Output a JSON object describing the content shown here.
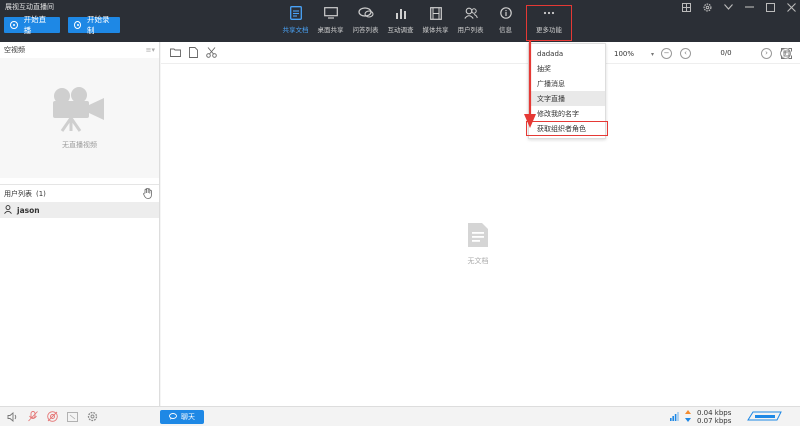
{
  "app": {
    "title": "展视互动直播间"
  },
  "header": {
    "start_live_label": "开始直播",
    "start_record_label": "开始录制",
    "tools": [
      {
        "label": "共享文档",
        "icon": "document-icon",
        "active": true
      },
      {
        "label": "桌面共享",
        "icon": "monitor-icon"
      },
      {
        "label": "问答列表",
        "icon": "chat-bubble-icon"
      },
      {
        "label": "互动调查",
        "icon": "bar-chart-icon"
      },
      {
        "label": "媒体共享",
        "icon": "film-icon"
      },
      {
        "label": "用户列表",
        "icon": "users-icon"
      },
      {
        "label": "信息",
        "icon": "info-icon"
      },
      {
        "label": "更多功能",
        "icon": "ellipsis-icon"
      }
    ]
  },
  "left_panel": {
    "video_title": "空视频",
    "no_video_caption": "无直播视频",
    "user_list_title": "用户列表",
    "user_count": "(1)",
    "users": [
      "jason"
    ]
  },
  "doc": {
    "zoom": "100%",
    "page_indicator": "0/0",
    "empty_caption": "无文档"
  },
  "more_menu": {
    "items": [
      "dadada",
      "抽奖",
      "广播消息",
      "文字直播",
      "修改我的名字",
      "获取组织者角色"
    ]
  },
  "footer": {
    "chat_label": "聊天",
    "upload_speed": "0.04 kbps",
    "download_speed": "0.07 kbps",
    "logo_text": "GENSEE 展视"
  },
  "colors": {
    "accent": "#1e88e5",
    "topbar": "#2b2f36",
    "highlight": "#e53935"
  }
}
